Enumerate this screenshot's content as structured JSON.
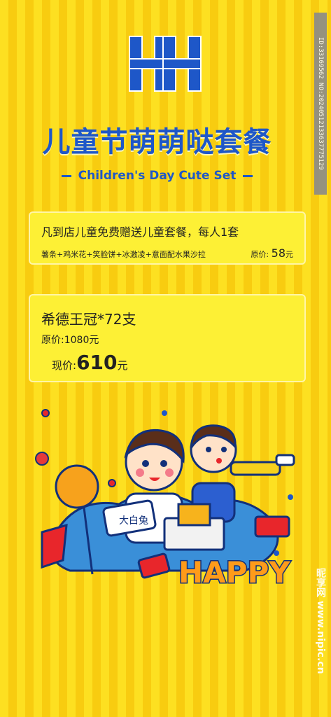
{
  "watermark": {
    "id": "ID:33169562 NO:20240512133637775129",
    "site": "昵享网 www.nipic.cn"
  },
  "logo": {
    "text": "HH",
    "color": "#1e57c8"
  },
  "header": {
    "title": "儿童节萌萌哒套餐",
    "subtitle": "Children's Day Cute Set"
  },
  "card1": {
    "headline": "凡到店儿童免费赠送儿童套餐，每人1套",
    "items": "薯条+鸡米花+笑脸饼+冰激凌+意面配水果沙拉",
    "price_label": "原价:",
    "price_value": "58",
    "price_unit": "元"
  },
  "card2": {
    "name": "希德王冠*72支",
    "original_label": "原价:",
    "original_value": "1080元",
    "now_label": "现价:",
    "now_value": "610",
    "now_unit": "元"
  },
  "illustration": {
    "happy_text": "HAPPY",
    "box_text": "大白兔"
  },
  "colors": {
    "brand_blue": "#1e57c8",
    "stripe_light": "#fde021",
    "stripe_dark": "#f8cc10",
    "card_bg": "#fdf035",
    "happy_orange": "#ff9b1a"
  }
}
